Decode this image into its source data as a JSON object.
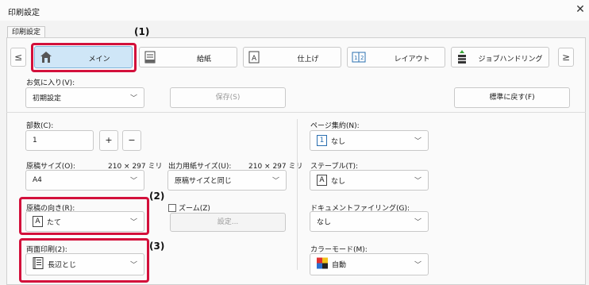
{
  "window": {
    "title": "印刷設定",
    "close_glyph": "✕"
  },
  "tab": {
    "label": "印刷設定"
  },
  "nav": {
    "prev": "≤",
    "next": "≥"
  },
  "segments": [
    {
      "label": "メイン",
      "icon": "home-icon"
    },
    {
      "label": "給紙",
      "icon": "paper-tray-icon"
    },
    {
      "label": "仕上げ",
      "icon": "finishing-icon"
    },
    {
      "label": "レイアウト",
      "icon": "layout-icon"
    },
    {
      "label": "ジョブハンドリング",
      "icon": "job-handling-icon"
    }
  ],
  "favorites": {
    "label": "お気に入り(V):",
    "value": "初期設定",
    "save_label": "保存(S)",
    "reset_label": "標準に戻す(F)"
  },
  "copies": {
    "label": "部数(C):",
    "value": "1",
    "plus": "+",
    "minus": "−"
  },
  "original_size": {
    "label": "原稿サイズ(O):",
    "dims": "210 × 297 ミリ",
    "value": "A4"
  },
  "output_size": {
    "label": "出力用紙サイズ(U):",
    "dims": "210 × 297 ミリ",
    "value": "原稿サイズと同じ"
  },
  "orientation": {
    "label": "原稿の向き(R):",
    "value": "たて",
    "icon_glyph": "A"
  },
  "zoom": {
    "label": "ズーム(Z)",
    "settings_label": "設定..."
  },
  "duplex": {
    "label": "両面印刷(2):",
    "value": "長辺とじ"
  },
  "pages_per_sheet": {
    "label": "ページ集約(N):",
    "value": "なし",
    "icon_glyph": "1"
  },
  "staple": {
    "label": "ステープル(T):",
    "value": "なし",
    "icon_glyph": "A"
  },
  "doc_filing": {
    "label": "ドキュメントファイリング(G):",
    "value": "なし"
  },
  "color_mode": {
    "label": "カラーモード(M):",
    "value": "自動"
  },
  "annotations": {
    "a1": "(1)",
    "a2": "(2)",
    "a3": "(3)"
  },
  "colors": {
    "highlight": "#d3103b",
    "selected_tab": "#cfe6f7"
  }
}
